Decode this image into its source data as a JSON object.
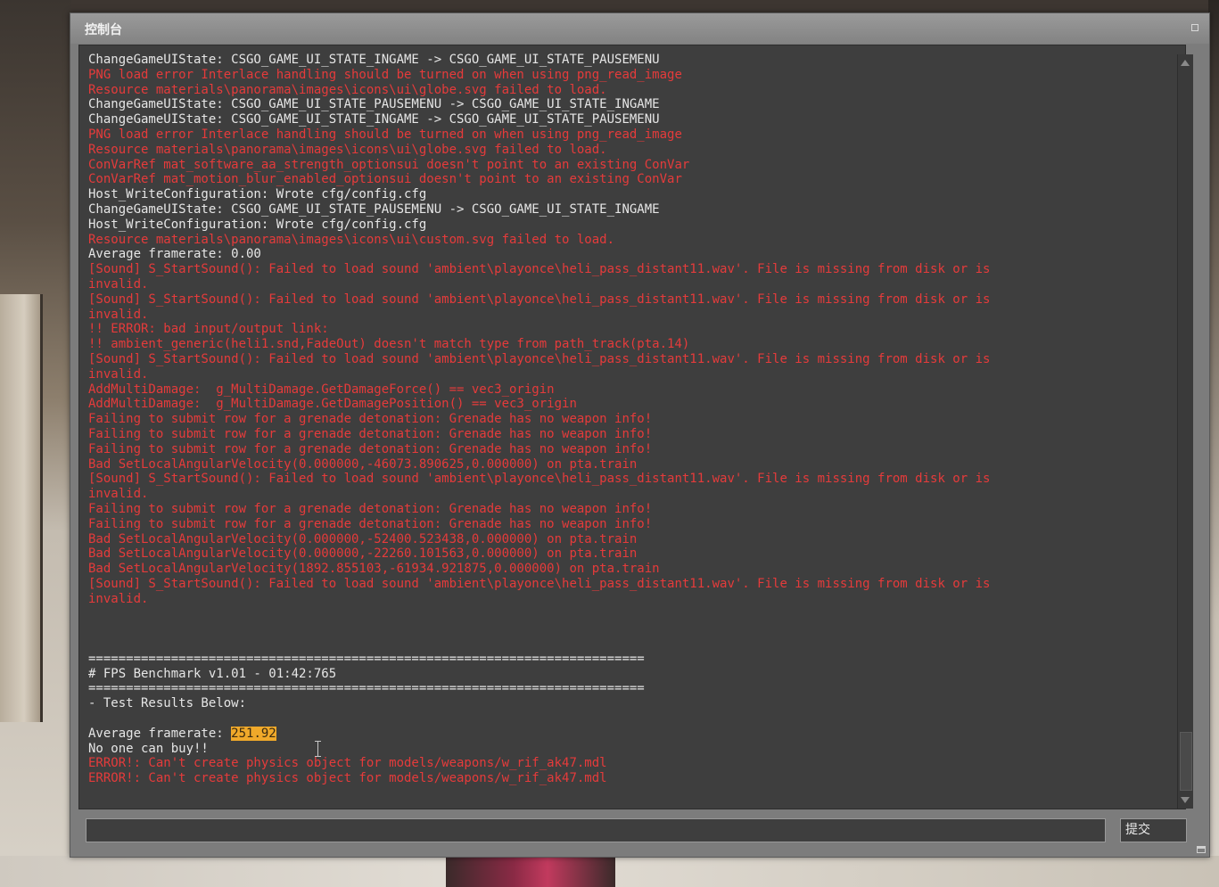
{
  "window": {
    "title": "控制台",
    "submit_label": "提交",
    "input_value": "",
    "input_placeholder": ""
  },
  "log": [
    {
      "text": "ChangeGameUIState: CSGO_GAME_UI_STATE_INGAME -> CSGO_GAME_UI_STATE_PAUSEMENU",
      "color": "white"
    },
    {
      "text": "PNG load error Interlace handling should be turned on when using png_read_image",
      "color": "red"
    },
    {
      "text": "Resource materials\\panorama\\images\\icons\\ui\\globe.svg failed to load.",
      "color": "red"
    },
    {
      "text": "ChangeGameUIState: CSGO_GAME_UI_STATE_PAUSEMENU -> CSGO_GAME_UI_STATE_INGAME",
      "color": "white"
    },
    {
      "text": "ChangeGameUIState: CSGO_GAME_UI_STATE_INGAME -> CSGO_GAME_UI_STATE_PAUSEMENU",
      "color": "white"
    },
    {
      "text": "PNG load error Interlace handling should be turned on when using png_read_image",
      "color": "red"
    },
    {
      "text": "Resource materials\\panorama\\images\\icons\\ui\\globe.svg failed to load.",
      "color": "red"
    },
    {
      "text": "ConVarRef mat_software_aa_strength_optionsui doesn't point to an existing ConVar",
      "color": "red"
    },
    {
      "text": "ConVarRef mat_motion_blur_enabled_optionsui doesn't point to an existing ConVar",
      "color": "red"
    },
    {
      "text": "Host_WriteConfiguration: Wrote cfg/config.cfg",
      "color": "white"
    },
    {
      "text": "ChangeGameUIState: CSGO_GAME_UI_STATE_PAUSEMENU -> CSGO_GAME_UI_STATE_INGAME",
      "color": "white"
    },
    {
      "text": "Host_WriteConfiguration: Wrote cfg/config.cfg",
      "color": "white"
    },
    {
      "text": "Resource materials\\panorama\\images\\icons\\ui\\custom.svg failed to load.",
      "color": "red"
    },
    {
      "text": "Average framerate: 0.00",
      "color": "white"
    },
    {
      "text": "[Sound] S_StartSound(): Failed to load sound 'ambient\\playonce\\heli_pass_distant11.wav'. File is missing from disk or is",
      "color": "red"
    },
    {
      "text": "invalid.",
      "color": "red"
    },
    {
      "text": "[Sound] S_StartSound(): Failed to load sound 'ambient\\playonce\\heli_pass_distant11.wav'. File is missing from disk or is",
      "color": "red"
    },
    {
      "text": "invalid.",
      "color": "red"
    },
    {
      "text": "!! ERROR: bad input/output link:",
      "color": "red"
    },
    {
      "text": "!! ambient_generic(heli1.snd,FadeOut) doesn't match type from path_track(pta.14)",
      "color": "red"
    },
    {
      "text": "[Sound] S_StartSound(): Failed to load sound 'ambient\\playonce\\heli_pass_distant11.wav'. File is missing from disk or is",
      "color": "red"
    },
    {
      "text": "invalid.",
      "color": "red"
    },
    {
      "text": "AddMultiDamage:  g_MultiDamage.GetDamageForce() == vec3_origin",
      "color": "red"
    },
    {
      "text": "AddMultiDamage:  g_MultiDamage.GetDamagePosition() == vec3_origin",
      "color": "red"
    },
    {
      "text": "Failing to submit row for a grenade detonation: Grenade has no weapon info!",
      "color": "red"
    },
    {
      "text": "Failing to submit row for a grenade detonation: Grenade has no weapon info!",
      "color": "red"
    },
    {
      "text": "Failing to submit row for a grenade detonation: Grenade has no weapon info!",
      "color": "red"
    },
    {
      "text": "Bad SetLocalAngularVelocity(0.000000,-46073.890625,0.000000) on pta.train",
      "color": "red"
    },
    {
      "text": "[Sound] S_StartSound(): Failed to load sound 'ambient\\playonce\\heli_pass_distant11.wav'. File is missing from disk or is",
      "color": "red"
    },
    {
      "text": "invalid.",
      "color": "red"
    },
    {
      "text": "Failing to submit row for a grenade detonation: Grenade has no weapon info!",
      "color": "red"
    },
    {
      "text": "Failing to submit row for a grenade detonation: Grenade has no weapon info!",
      "color": "red"
    },
    {
      "text": "Bad SetLocalAngularVelocity(0.000000,-52400.523438,0.000000) on pta.train",
      "color": "red"
    },
    {
      "text": "Bad SetLocalAngularVelocity(0.000000,-22260.101563,0.000000) on pta.train",
      "color": "red"
    },
    {
      "text": "Bad SetLocalAngularVelocity(1892.855103,-61934.921875,0.000000) on pta.train",
      "color": "red"
    },
    {
      "text": "[Sound] S_StartSound(): Failed to load sound 'ambient\\playonce\\heli_pass_distant11.wav'. File is missing from disk or is",
      "color": "red"
    },
    {
      "text": "invalid.",
      "color": "red"
    },
    {
      "text": "",
      "color": "white"
    },
    {
      "text": "",
      "color": "white"
    },
    {
      "text": "",
      "color": "white"
    },
    {
      "text": "==========================================================================",
      "color": "white"
    },
    {
      "text": "# FPS Benchmark v1.01 - 01:42:765",
      "color": "white"
    },
    {
      "text": "==========================================================================",
      "color": "white"
    },
    {
      "text": "- Test Results Below:",
      "color": "white"
    },
    {
      "text": "",
      "color": "white"
    },
    {
      "text": "Average framerate: ",
      "color": "white",
      "highlight": "251.92"
    },
    {
      "text": "No one can buy!!",
      "color": "white"
    },
    {
      "text": "ERROR!: Can't create physics object for models/weapons/w_rif_ak47.mdl",
      "color": "red"
    },
    {
      "text": "ERROR!: Can't create physics object for models/weapons/w_rif_ak47.mdl",
      "color": "red"
    }
  ],
  "colors": {
    "log_white": "#e6e6e6",
    "log_red": "#e53b3b",
    "highlight_bg": "#f0a92a",
    "window_bg": "#7c7c7c",
    "log_bg": "#3e3e3e"
  },
  "icons": [
    "maximize-icon",
    "scroll-up-icon",
    "scroll-down-icon",
    "resize-grip-icon",
    "text-cursor-icon"
  ]
}
